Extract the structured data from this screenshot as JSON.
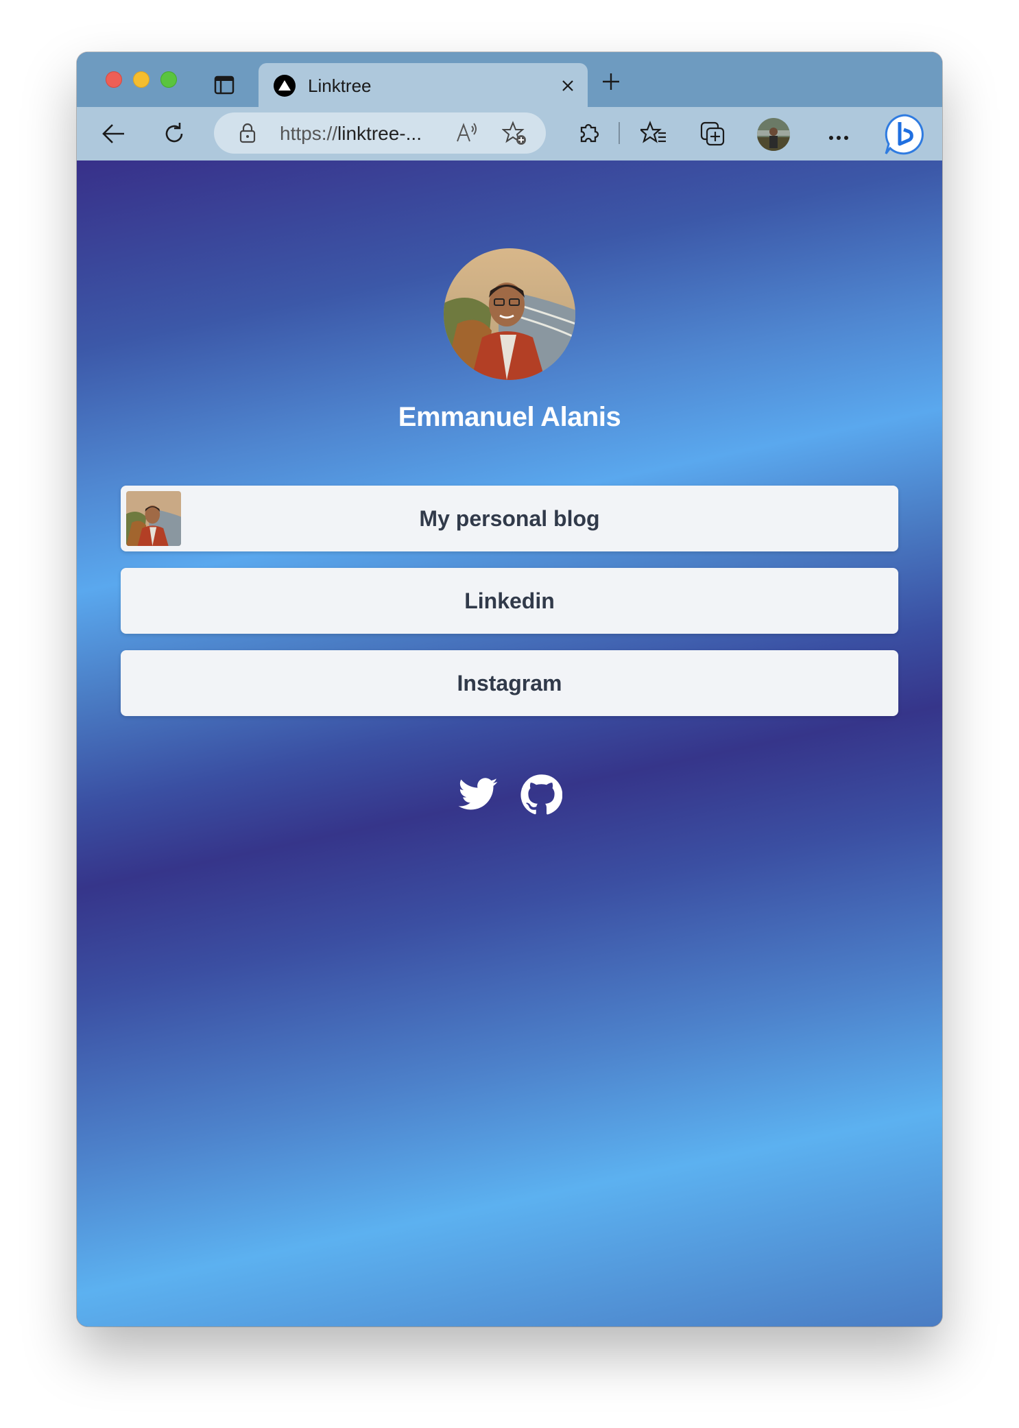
{
  "browser": {
    "tab": {
      "title": "Linktree"
    },
    "address_bar": {
      "url_scheme": "https://",
      "url_rest": "linktree-..."
    }
  },
  "profile": {
    "name": "Emmanuel Alanis"
  },
  "links": [
    {
      "label": "My personal blog",
      "has_thumbnail": true
    },
    {
      "label": "Linkedin",
      "has_thumbnail": false
    },
    {
      "label": "Instagram",
      "has_thumbnail": false
    }
  ],
  "social_icons": [
    "twitter-icon",
    "github-icon"
  ],
  "colors": {
    "gradient_dark": "#36358a",
    "gradient_light": "#5cb1f0",
    "button_bg": "#f2f4f7",
    "button_text": "#313a4a",
    "name_text": "#ffffff"
  }
}
